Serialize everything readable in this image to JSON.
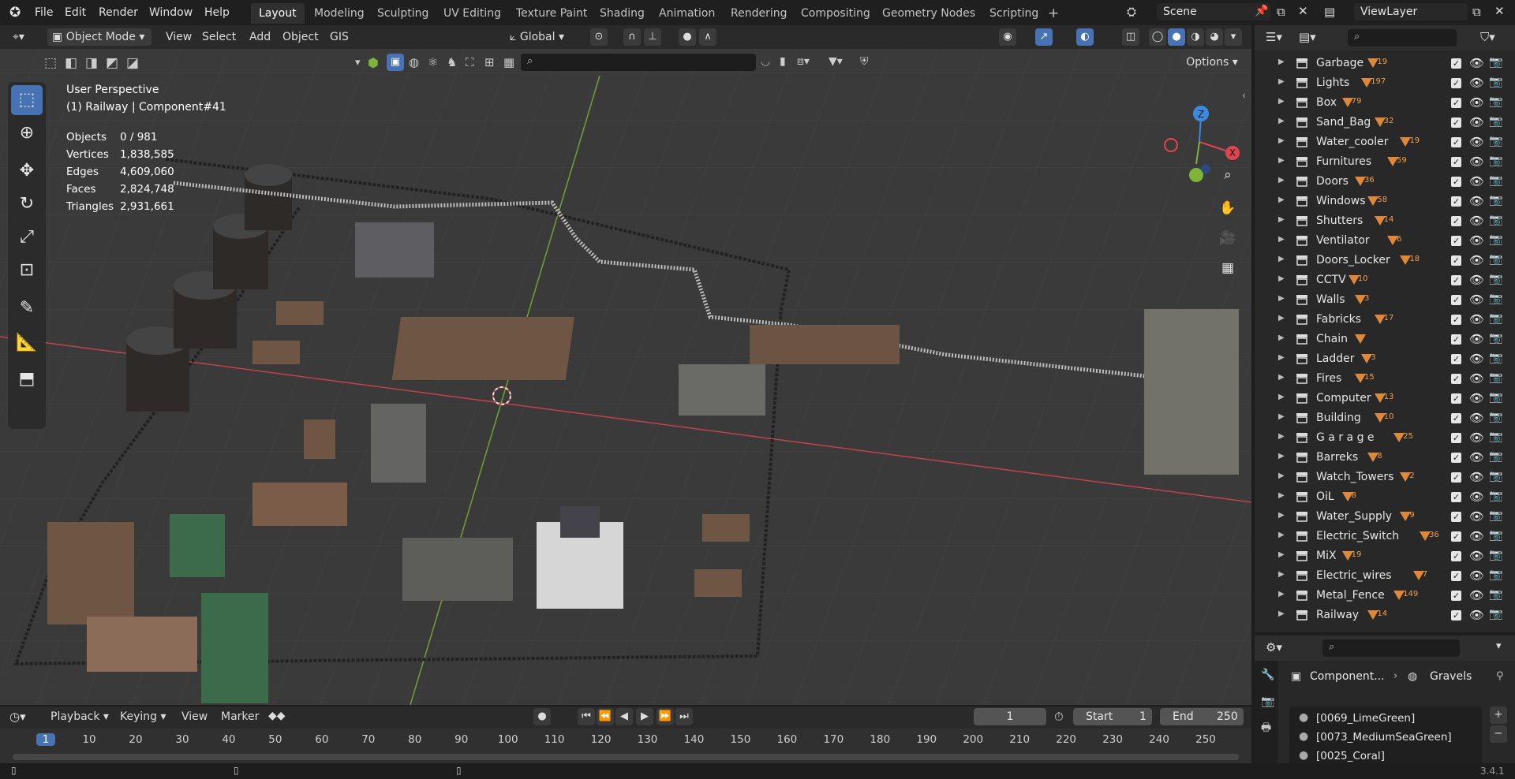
{
  "app": {
    "menu": [
      "File",
      "Edit",
      "Render",
      "Window",
      "Help"
    ],
    "workspaces": [
      "Layout",
      "Modeling",
      "Sculpting",
      "UV Editing",
      "Texture Paint",
      "Shading",
      "Animation",
      "Rendering",
      "Compositing",
      "Geometry Nodes",
      "Scripting"
    ],
    "active_workspace": "Layout",
    "add_workspace": "+",
    "scene": "Scene",
    "view_layer": "ViewLayer"
  },
  "viewport_header": {
    "mode": "Object Mode",
    "menus": [
      "View",
      "Select",
      "Add",
      "Object",
      "GIS"
    ],
    "transform_orientation": "Global",
    "options_label": "Options"
  },
  "overlay_text": {
    "perspective": "User Perspective",
    "context": "(1) Railway | Component#41",
    "stats": [
      {
        "label": "Objects",
        "value": "0 / 981"
      },
      {
        "label": "Vertices",
        "value": "1,838,585"
      },
      {
        "label": "Edges",
        "value": "4,609,060"
      },
      {
        "label": "Faces",
        "value": "2,824,748"
      },
      {
        "label": "Triangles",
        "value": "2,931,661"
      }
    ]
  },
  "gizmo": {
    "x": "X",
    "y": "Y",
    "z": "Z"
  },
  "outliner": {
    "rows": [
      {
        "name": "Garbage",
        "count": "19"
      },
      {
        "name": "Lights",
        "count": "197"
      },
      {
        "name": "Box",
        "count": "79"
      },
      {
        "name": "Sand_Bag",
        "count": "32"
      },
      {
        "name": "Water_cooler",
        "count": "19"
      },
      {
        "name": "Furnitures",
        "count": "59"
      },
      {
        "name": "Doors",
        "count": "36"
      },
      {
        "name": "Windows",
        "count": "58"
      },
      {
        "name": "Shutters",
        "count": "14"
      },
      {
        "name": "Ventilator",
        "count": "6"
      },
      {
        "name": "Doors_Locker",
        "count": "18"
      },
      {
        "name": "CCTV",
        "count": "10"
      },
      {
        "name": "Walls",
        "count": "3"
      },
      {
        "name": "Fabricks",
        "count": "17"
      },
      {
        "name": "Chain",
        "count": ""
      },
      {
        "name": "Ladder",
        "count": "3"
      },
      {
        "name": "Fires",
        "count": "15"
      },
      {
        "name": "Computer",
        "count": "13"
      },
      {
        "name": "Building",
        "count": "10"
      },
      {
        "name": "G a r a g e",
        "count": "25"
      },
      {
        "name": "Barreks",
        "count": "8"
      },
      {
        "name": "Watch_Towers",
        "count": "2"
      },
      {
        "name": "OiL",
        "count": "8"
      },
      {
        "name": "Water_Supply",
        "count": "9"
      },
      {
        "name": "Electric_Switch",
        "count": "36"
      },
      {
        "name": "MiX",
        "count": "19"
      },
      {
        "name": "Electric_wires",
        "count": "7"
      },
      {
        "name": "Metal_Fence",
        "count": "149"
      },
      {
        "name": "Railway",
        "count": "14"
      }
    ]
  },
  "properties": {
    "breadcrumb_object": "Component...",
    "breadcrumb_material": "Gravels",
    "materials": [
      "[0069_LimeGreen]",
      "[0073_MediumSeaGreen]",
      "[0025_Coral]"
    ]
  },
  "timeline": {
    "menus": [
      "Playback",
      "Keying",
      "View",
      "Marker"
    ],
    "current_frame": "1",
    "start_label": "Start",
    "start": "1",
    "end_label": "End",
    "end": "250",
    "ruler": [
      "1",
      "10",
      "20",
      "30",
      "40",
      "50",
      "60",
      "70",
      "80",
      "90",
      "100",
      "110",
      "120",
      "130",
      "140",
      "150",
      "160",
      "170",
      "180",
      "190",
      "200",
      "210",
      "220",
      "230",
      "240",
      "250"
    ]
  },
  "status": {
    "version": "3.4.1"
  },
  "colors": {
    "accent": "#4772b3",
    "x_axis": "#e0454f",
    "y_axis": "#7fb33a",
    "z_axis": "#3a8be0",
    "collection_tri": "#e0883a"
  }
}
